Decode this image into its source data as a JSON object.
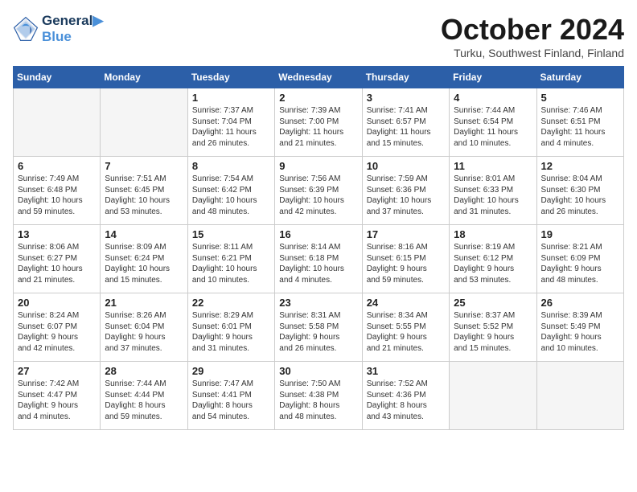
{
  "header": {
    "logo_line1": "General",
    "logo_line2": "Blue",
    "month": "October 2024",
    "location": "Turku, Southwest Finland, Finland"
  },
  "days_of_week": [
    "Sunday",
    "Monday",
    "Tuesday",
    "Wednesday",
    "Thursday",
    "Friday",
    "Saturday"
  ],
  "weeks": [
    [
      {
        "day": "",
        "content": ""
      },
      {
        "day": "",
        "content": ""
      },
      {
        "day": "1",
        "content": "Sunrise: 7:37 AM\nSunset: 7:04 PM\nDaylight: 11 hours\nand 26 minutes."
      },
      {
        "day": "2",
        "content": "Sunrise: 7:39 AM\nSunset: 7:00 PM\nDaylight: 11 hours\nand 21 minutes."
      },
      {
        "day": "3",
        "content": "Sunrise: 7:41 AM\nSunset: 6:57 PM\nDaylight: 11 hours\nand 15 minutes."
      },
      {
        "day": "4",
        "content": "Sunrise: 7:44 AM\nSunset: 6:54 PM\nDaylight: 11 hours\nand 10 minutes."
      },
      {
        "day": "5",
        "content": "Sunrise: 7:46 AM\nSunset: 6:51 PM\nDaylight: 11 hours\nand 4 minutes."
      }
    ],
    [
      {
        "day": "6",
        "content": "Sunrise: 7:49 AM\nSunset: 6:48 PM\nDaylight: 10 hours\nand 59 minutes."
      },
      {
        "day": "7",
        "content": "Sunrise: 7:51 AM\nSunset: 6:45 PM\nDaylight: 10 hours\nand 53 minutes."
      },
      {
        "day": "8",
        "content": "Sunrise: 7:54 AM\nSunset: 6:42 PM\nDaylight: 10 hours\nand 48 minutes."
      },
      {
        "day": "9",
        "content": "Sunrise: 7:56 AM\nSunset: 6:39 PM\nDaylight: 10 hours\nand 42 minutes."
      },
      {
        "day": "10",
        "content": "Sunrise: 7:59 AM\nSunset: 6:36 PM\nDaylight: 10 hours\nand 37 minutes."
      },
      {
        "day": "11",
        "content": "Sunrise: 8:01 AM\nSunset: 6:33 PM\nDaylight: 10 hours\nand 31 minutes."
      },
      {
        "day": "12",
        "content": "Sunrise: 8:04 AM\nSunset: 6:30 PM\nDaylight: 10 hours\nand 26 minutes."
      }
    ],
    [
      {
        "day": "13",
        "content": "Sunrise: 8:06 AM\nSunset: 6:27 PM\nDaylight: 10 hours\nand 21 minutes."
      },
      {
        "day": "14",
        "content": "Sunrise: 8:09 AM\nSunset: 6:24 PM\nDaylight: 10 hours\nand 15 minutes."
      },
      {
        "day": "15",
        "content": "Sunrise: 8:11 AM\nSunset: 6:21 PM\nDaylight: 10 hours\nand 10 minutes."
      },
      {
        "day": "16",
        "content": "Sunrise: 8:14 AM\nSunset: 6:18 PM\nDaylight: 10 hours\nand 4 minutes."
      },
      {
        "day": "17",
        "content": "Sunrise: 8:16 AM\nSunset: 6:15 PM\nDaylight: 9 hours\nand 59 minutes."
      },
      {
        "day": "18",
        "content": "Sunrise: 8:19 AM\nSunset: 6:12 PM\nDaylight: 9 hours\nand 53 minutes."
      },
      {
        "day": "19",
        "content": "Sunrise: 8:21 AM\nSunset: 6:09 PM\nDaylight: 9 hours\nand 48 minutes."
      }
    ],
    [
      {
        "day": "20",
        "content": "Sunrise: 8:24 AM\nSunset: 6:07 PM\nDaylight: 9 hours\nand 42 minutes."
      },
      {
        "day": "21",
        "content": "Sunrise: 8:26 AM\nSunset: 6:04 PM\nDaylight: 9 hours\nand 37 minutes."
      },
      {
        "day": "22",
        "content": "Sunrise: 8:29 AM\nSunset: 6:01 PM\nDaylight: 9 hours\nand 31 minutes."
      },
      {
        "day": "23",
        "content": "Sunrise: 8:31 AM\nSunset: 5:58 PM\nDaylight: 9 hours\nand 26 minutes."
      },
      {
        "day": "24",
        "content": "Sunrise: 8:34 AM\nSunset: 5:55 PM\nDaylight: 9 hours\nand 21 minutes."
      },
      {
        "day": "25",
        "content": "Sunrise: 8:37 AM\nSunset: 5:52 PM\nDaylight: 9 hours\nand 15 minutes."
      },
      {
        "day": "26",
        "content": "Sunrise: 8:39 AM\nSunset: 5:49 PM\nDaylight: 9 hours\nand 10 minutes."
      }
    ],
    [
      {
        "day": "27",
        "content": "Sunrise: 7:42 AM\nSunset: 4:47 PM\nDaylight: 9 hours\nand 4 minutes."
      },
      {
        "day": "28",
        "content": "Sunrise: 7:44 AM\nSunset: 4:44 PM\nDaylight: 8 hours\nand 59 minutes."
      },
      {
        "day": "29",
        "content": "Sunrise: 7:47 AM\nSunset: 4:41 PM\nDaylight: 8 hours\nand 54 minutes."
      },
      {
        "day": "30",
        "content": "Sunrise: 7:50 AM\nSunset: 4:38 PM\nDaylight: 8 hours\nand 48 minutes."
      },
      {
        "day": "31",
        "content": "Sunrise: 7:52 AM\nSunset: 4:36 PM\nDaylight: 8 hours\nand 43 minutes."
      },
      {
        "day": "",
        "content": ""
      },
      {
        "day": "",
        "content": ""
      }
    ]
  ]
}
